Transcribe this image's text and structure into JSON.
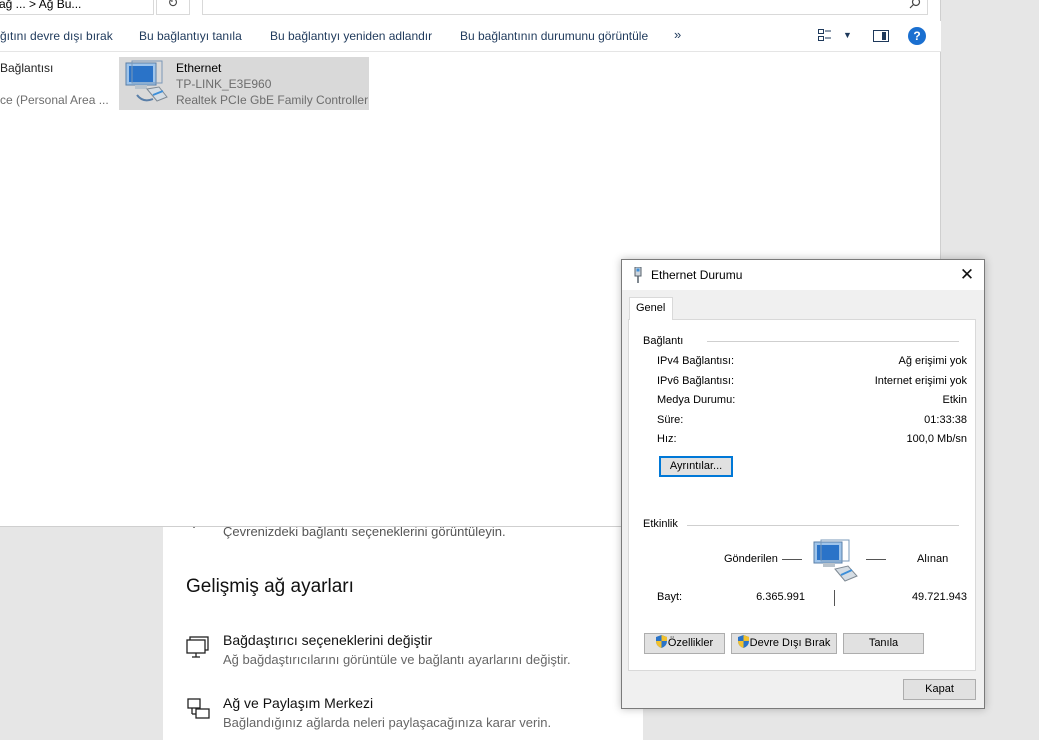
{
  "explorer": {
    "breadcrumb": "ağ ... > Ağ Bu...",
    "commands": [
      "ğıtını devre dışı bırak",
      "Bu bağlantıyı tanıla",
      "Bu bağlantıyı yeniden adlandır",
      "Bu bağlantının durumunu görüntüle"
    ],
    "more": "»",
    "left_items": [
      "Bağlantısı",
      "ce (Personal Area ..."
    ],
    "ethernet": {
      "name": "Ethernet",
      "network": "TP-LINK_E3E960",
      "adapter": "Realtek PCIe GbE Family Controller"
    }
  },
  "settings": {
    "top_desc": "Çevrenizdeki bağlantı seçeneklerini görüntüleyin.",
    "heading": "Gelişmiş ağ ayarları",
    "items": [
      {
        "title": "Bağdaştırıcı seçeneklerini değiştir",
        "desc": "Ağ bağdaştırıcılarını görüntüle ve bağlantı ayarlarını değiştir."
      },
      {
        "title": "Ağ ve Paylaşım Merkezi",
        "desc": "Bağlandığınız ağlarda neleri paylaşacağınıza karar verin."
      }
    ]
  },
  "dialog": {
    "title": "Ethernet Durumu",
    "close": "✕",
    "tab": "Genel",
    "connection_group": "Bağlantı",
    "rows": [
      {
        "label": "IPv4 Bağlantısı:",
        "value": "Ağ erişimi yok"
      },
      {
        "label": "IPv6 Bağlantısı:",
        "value": "Internet erişimi yok"
      },
      {
        "label": "Medya Durumu:",
        "value": "Etkin"
      },
      {
        "label": "Süre:",
        "value": "01:33:38"
      },
      {
        "label": "Hız:",
        "value": "100,0 Mb/sn"
      }
    ],
    "details_button": "Ayrıntılar...",
    "activity_group": "Etkinlik",
    "sent_label": "Gönderilen",
    "received_label": "Alınan",
    "bytes_label": "Bayt:",
    "bytes_sent": "6.365.991",
    "bytes_received": "49.721.943",
    "buttons": {
      "properties": "Özellikler",
      "disable": "Devre Dışı Bırak",
      "diagnose": "Tanıla",
      "close": "Kapat"
    }
  }
}
